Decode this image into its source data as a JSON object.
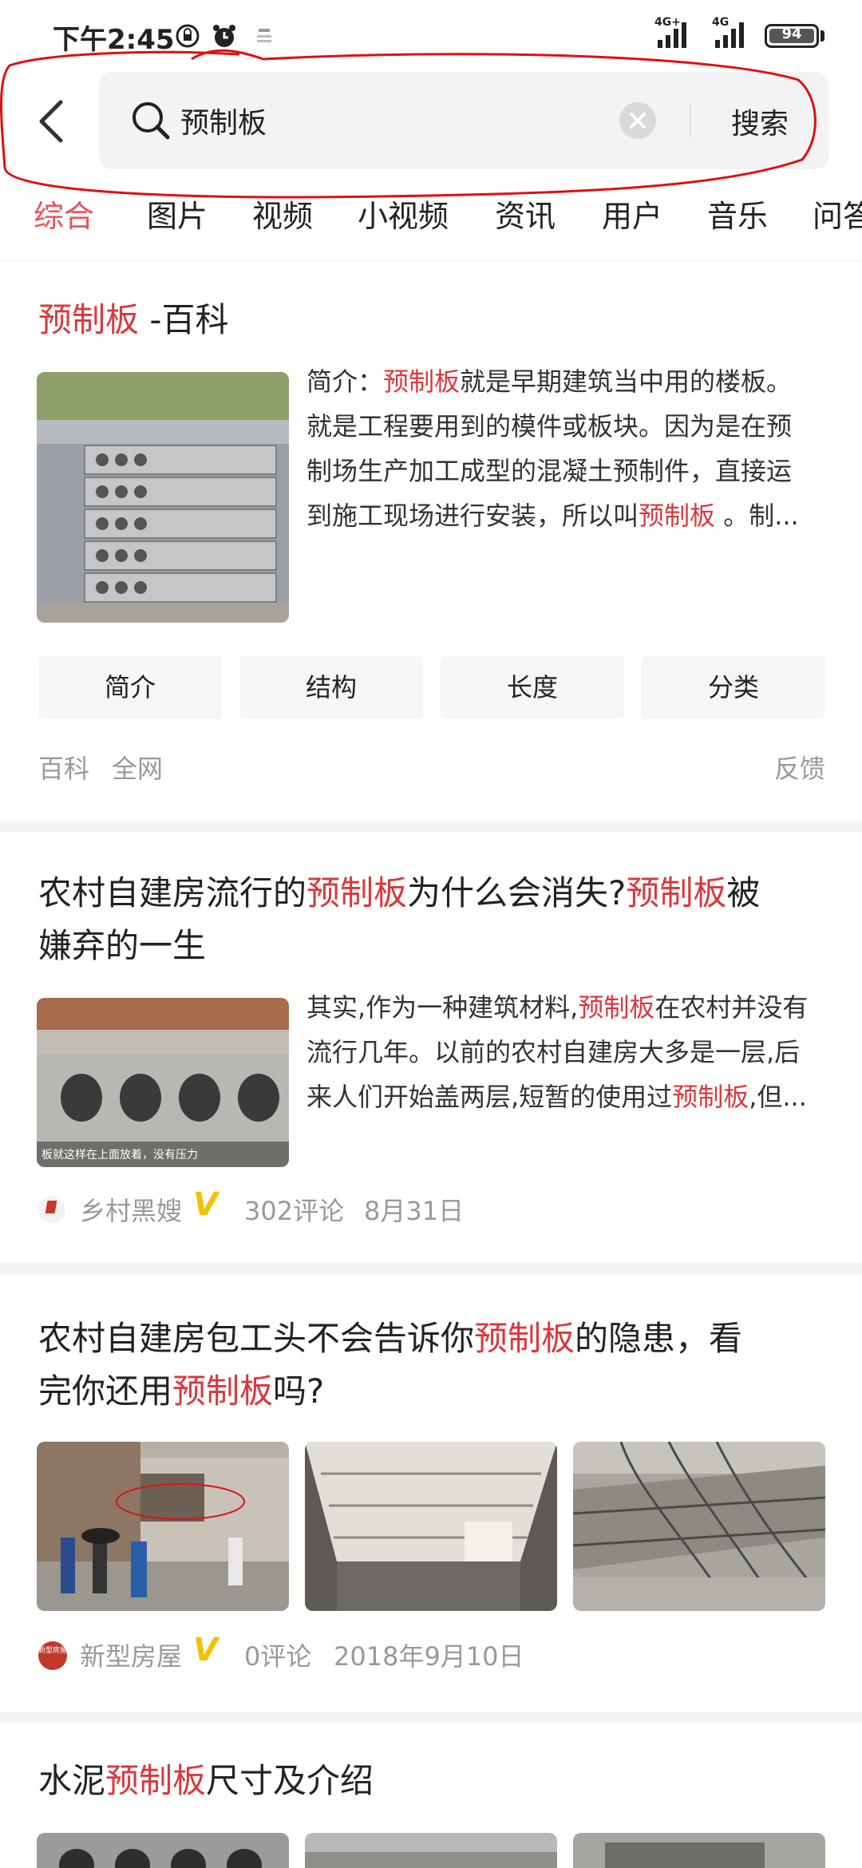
{
  "status_bar": {
    "time": "下午2:45",
    "signal_labels": [
      "4G+",
      "4G"
    ],
    "battery": "94"
  },
  "search": {
    "query": "预制板",
    "button_label": "搜索"
  },
  "tabs": [
    "综合",
    "图片",
    "视频",
    "小视频",
    "资讯",
    "用户",
    "音乐",
    "问答"
  ],
  "baike": {
    "title_hl": "预制板",
    "title_rest": " -百科",
    "lines": [
      {
        "pre": "简介：",
        "hl": "预制板",
        "post": "就是早期建筑当中用的楼板。"
      },
      {
        "pre": "就是工程要用到的模件或板块。因为是在预",
        "hl": "",
        "post": ""
      },
      {
        "pre": "制场生产加工成型的混凝土预制件，直接运",
        "hl": "",
        "post": ""
      },
      {
        "pre": "到施工现场进行安装，所以叫",
        "hl": "预制板",
        "post": " 。制..."
      }
    ],
    "pills": [
      "简介",
      "结构",
      "长度",
      "分类"
    ],
    "source_1": "百科",
    "source_2": "全网",
    "feedback": "反馈"
  },
  "article1": {
    "title_line1": {
      "a": "农村自建房流行的",
      "b": "预制板",
      "c": "为什么会消失?",
      "d": "预制板",
      "e": "被"
    },
    "title_line2": "嫌弃的一生",
    "lines": [
      {
        "pre": "其实,作为一种建筑材料,",
        "hl": "预制板",
        "post": "在农村并没有"
      },
      {
        "pre": "流行几年。以前的农村自建房大多是一层,后",
        "hl": "",
        "post": ""
      },
      {
        "pre": "来人们开始盖两层,短暂的使用过",
        "hl": "预制板",
        "post": ",但..."
      }
    ],
    "image_caption": "板就这样在上面放着，没有压力",
    "author": "乡村黑嫂",
    "comments": "302评论",
    "date": "8月31日"
  },
  "article2": {
    "title_line1": {
      "a": "农村自建房包工头不会告诉你",
      "b": "预制板",
      "c": "的隐患，看"
    },
    "title_line2": {
      "a": "完你还用",
      "b": "预制板",
      "c": "吗?"
    },
    "author": "新型房屋",
    "avatar_text": "新型房屋",
    "comments": "0评论",
    "date": "2018年9月10日"
  },
  "article3": {
    "title": {
      "a": "水泥",
      "b": "预制板",
      "c": "尺寸及介绍"
    }
  },
  "colors": {
    "highlight": "#d9383d",
    "tab_active": "#e65458",
    "annotation": "#e01010",
    "verified": "#f2c200"
  }
}
